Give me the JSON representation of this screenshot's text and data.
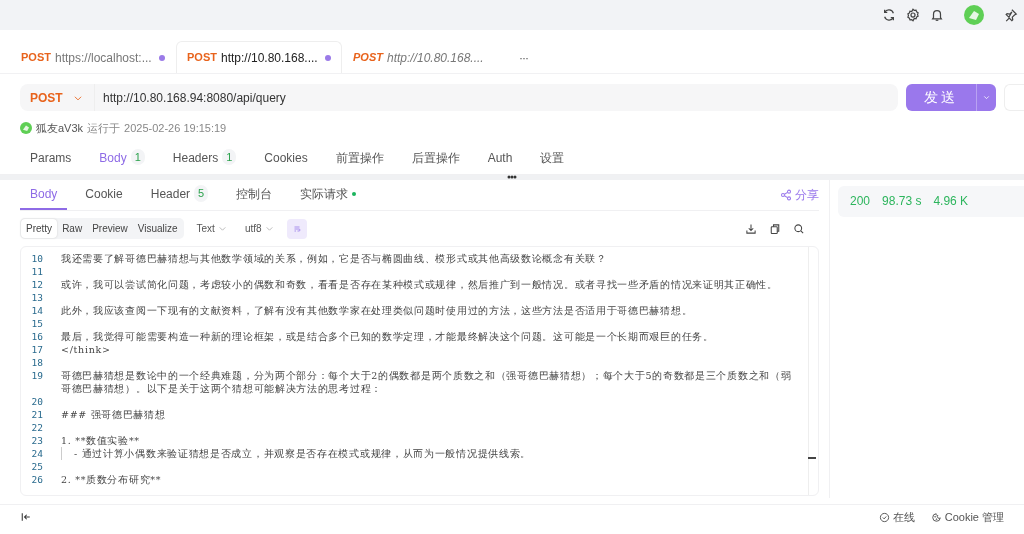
{
  "request_tabs": [
    {
      "method": "POST",
      "url": "https://localhost:...",
      "unsaved": true,
      "selected": false,
      "italic": false
    },
    {
      "method": "POST",
      "url": "http://10.80.168....",
      "unsaved": true,
      "selected": true,
      "italic": false
    },
    {
      "method": "POST",
      "url": "http://10.80.168....",
      "unsaved": false,
      "selected": false,
      "italic": true
    }
  ],
  "more_tabs": "···",
  "request": {
    "method": "POST",
    "url": "http://10.80.168.94:8080/api/query",
    "send": "发送"
  },
  "run_info": {
    "user": "狐友aV3k",
    "label": "运行于",
    "time": "2025-02-26 19:15:19"
  },
  "param_tabs": [
    {
      "label": "Params",
      "selected": false
    },
    {
      "label": "Body",
      "count": "1",
      "selected": true
    },
    {
      "label": "Headers",
      "count": "1",
      "selected": false
    },
    {
      "label": "Cookies",
      "selected": false
    },
    {
      "label": "前置操作",
      "selected": false
    },
    {
      "label": "后置操作",
      "selected": false
    },
    {
      "label": "Auth",
      "selected": false
    },
    {
      "label": "设置",
      "selected": false
    }
  ],
  "response_tabs": [
    {
      "label": "Body",
      "selected": true
    },
    {
      "label": "Cookie",
      "selected": false
    },
    {
      "label": "Header",
      "count": "5",
      "selected": false
    },
    {
      "label": "控制台",
      "selected": false
    },
    {
      "label": "实际请求",
      "dot": true,
      "selected": false
    }
  ],
  "share": "分享",
  "view_modes": [
    {
      "label": "Pretty",
      "selected": true
    },
    {
      "label": "Raw",
      "selected": false
    },
    {
      "label": "Preview",
      "selected": false
    },
    {
      "label": "Visualize",
      "selected": false
    }
  ],
  "format": "Text",
  "encoding": "utf8",
  "wrap_on": true,
  "code_lines": [
    {
      "number": "10",
      "text": "我还需要了解哥德巴赫猜想与其他数学领域的关系，例如，它是否与椭圆曲线、模形式或其他高级数论概念有关联？"
    },
    {
      "number": "11"
    },
    {
      "number": "12",
      "text": "或许，我可以尝试简化问题，考虑较小的偶数和奇数，看看是否存在某种模式或规律，然后推广到一般情况。或者寻找一些矛盾的情况来证明其正确性。"
    },
    {
      "number": "13"
    },
    {
      "number": "14",
      "text": "此外，我应该查阅一下现有的文献资料，了解有没有其他数学家在处理类似问题时使用过的方法，这些方法是否适用于哥德巴赫猜想。"
    },
    {
      "number": "15"
    },
    {
      "number": "16",
      "text": "最后，我觉得可能需要构造一种新的理论框架，或是结合多个已知的数学定理，才能最终解决这个问题。这可能是一个长期而艰巨的任务。"
    },
    {
      "number": "17",
      "text": "</think>"
    },
    {
      "number": "18"
    },
    {
      "number": "19",
      "text": "哥德巴赫猜想是数论中的一个经典难题，分为两个部分：每个大于2的偶数都是两个质数之和（强哥德巴赫猜想）；每个大于5的奇数都是三个质数之和（弱哥德巴赫猜想）。以下是关于这两个猜想可能解决方法的思考过程："
    },
    {
      "number": "20"
    },
    {
      "number": "21",
      "text": "### 强哥德巴赫猜想"
    },
    {
      "number": "22"
    },
    {
      "number": "23",
      "text": "1. **数值实验**"
    },
    {
      "number": "24",
      "text": "- 通过计算小偶数来验证猜想是否成立，并观察是否存在模式或规律，从而为一般情况提供线索。",
      "indent": true
    },
    {
      "number": "25"
    },
    {
      "number": "26",
      "text": "2. **质数分布研究**"
    }
  ],
  "response_status": {
    "code": "200",
    "time": "98.73 s",
    "size": "4.96 K"
  },
  "status_bar": [
    {
      "label": "在线"
    },
    {
      "label": "Cookie 管理"
    }
  ]
}
